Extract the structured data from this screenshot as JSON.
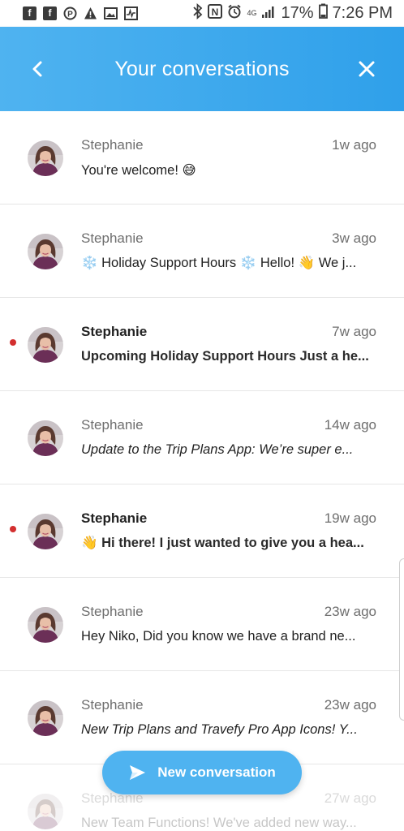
{
  "status_bar": {
    "battery": "17%",
    "time": "7:26 PM",
    "network": "4G",
    "left_icons": [
      "facebook-icon",
      "facebook-icon",
      "pinterest-icon",
      "warning-icon",
      "image-icon",
      "pulse-icon"
    ],
    "right_icons": [
      "bluetooth-icon",
      "nfc-icon",
      "alarm-icon",
      "signal-icon",
      "battery-icon"
    ]
  },
  "header": {
    "title": "Your conversations",
    "back_icon": "chevron-left-icon",
    "close_icon": "close-icon"
  },
  "conversations": [
    {
      "name": "Stephanie",
      "time": "1w ago",
      "preview": "You're welcome! 😅",
      "unread": false,
      "italic": false
    },
    {
      "name": "Stephanie",
      "time": "3w ago",
      "preview": "❄️ Holiday Support Hours ❄️ Hello! 👋  We j...",
      "unread": false,
      "italic": false
    },
    {
      "name": "Stephanie",
      "time": "7w ago",
      "preview": "Upcoming Holiday Support Hours Just a he...",
      "unread": true,
      "italic": false
    },
    {
      "name": "Stephanie",
      "time": "14w ago",
      "preview": "Update to the Trip Plans App: We’re super e...",
      "unread": false,
      "italic": true
    },
    {
      "name": "Stephanie",
      "time": "19w ago",
      "preview": "👋 Hi there! I just wanted to give you a hea...",
      "unread": true,
      "italic": false
    },
    {
      "name": "Stephanie",
      "time": "23w ago",
      "preview": "Hey Niko, Did you know we have a brand ne...",
      "unread": false,
      "italic": false
    },
    {
      "name": "Stephanie",
      "time": "23w ago",
      "preview": "New Trip Plans and Travefy Pro App Icons! Y...",
      "unread": false,
      "italic": true
    },
    {
      "name": "Stephanie",
      "time": "27w ago",
      "preview": "New Team Functions! We've added new way...",
      "unread": false,
      "italic": false
    }
  ],
  "new_conversation": {
    "label": "New conversation",
    "icon": "send-icon"
  },
  "colors": {
    "header": "#2fa0ea",
    "accent": "#4fb3f0",
    "unread_dot": "#d32f2f"
  }
}
